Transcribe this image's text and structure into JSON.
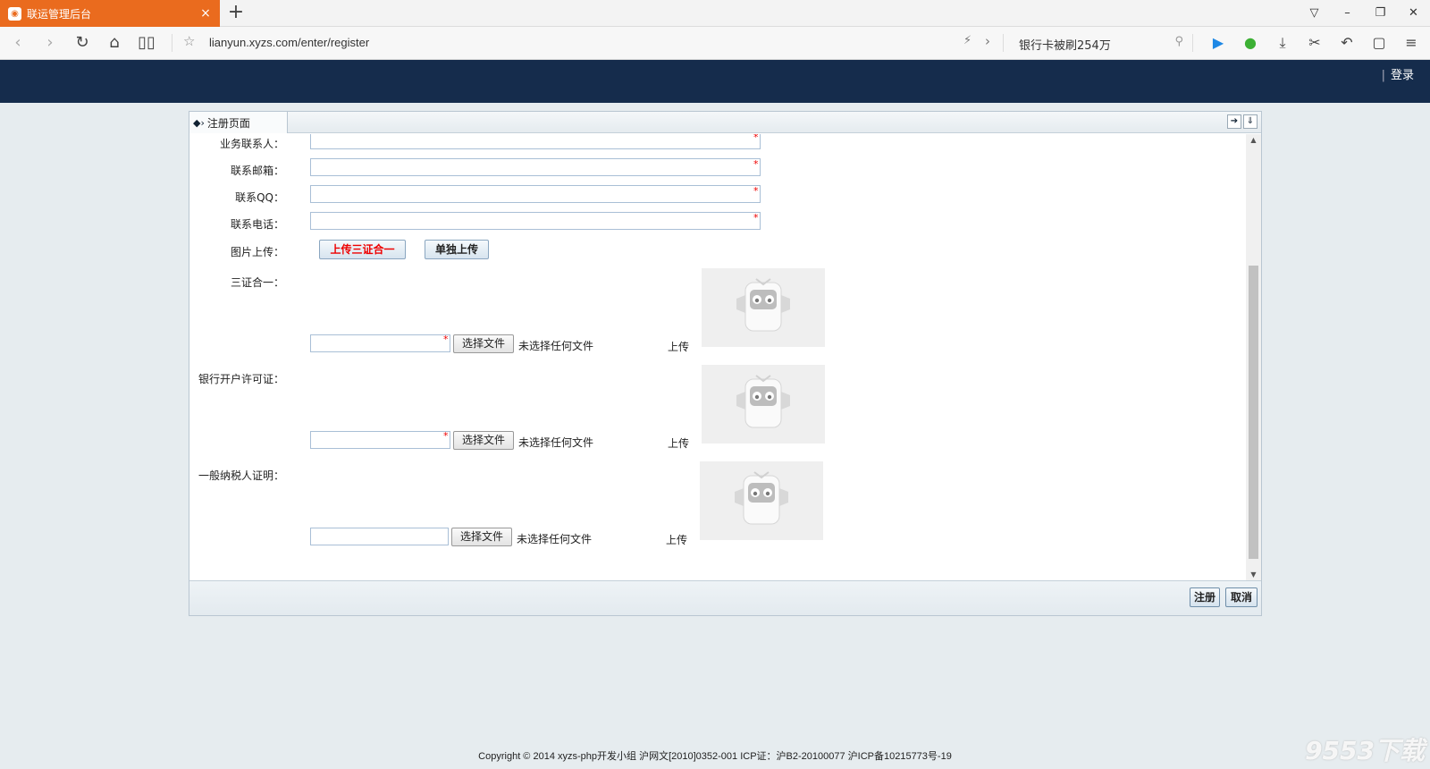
{
  "browser": {
    "tab_title": "联运管理后台",
    "tab_favicon": "monkey-favicon",
    "url": "lianyun.xyzs.com/enter/register",
    "search_query": "银行卡被刷254万"
  },
  "header": {
    "login_label": "登录"
  },
  "panel": {
    "tab_label": "注册页面",
    "fields": [
      {
        "label": "业务联系人：",
        "value": ""
      },
      {
        "label": "联系邮箱：",
        "value": ""
      },
      {
        "label": "联系QQ：",
        "value": ""
      },
      {
        "label": "联系电话：",
        "value": ""
      }
    ],
    "required_mark": "*",
    "image_upload": {
      "label": "图片上传：",
      "btn_combined": "上传三证合一",
      "btn_separate": "单独上传"
    },
    "documents": [
      {
        "label": "三证合一：",
        "choose_file": "选择文件",
        "no_file": "未选择任何文件",
        "upload": "上传"
      },
      {
        "label": "银行开户许可证：",
        "choose_file": "选择文件",
        "no_file": "未选择任何文件",
        "upload": "上传"
      },
      {
        "label": "一般纳税人证明：",
        "choose_file": "选择文件",
        "no_file": "未选择任何文件",
        "upload": "上传"
      }
    ],
    "register_button": "注册",
    "cancel_button": "取消"
  },
  "footer": {
    "copyright": "Copyright © 2014 xyzs-php开发小组 沪网文[2010]0352-001 ICP证：沪B2-20100077 沪ICP备10215773号-19"
  },
  "watermark": "9553下载"
}
